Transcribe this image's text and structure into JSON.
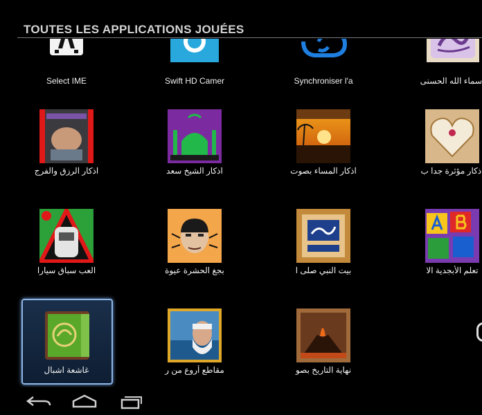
{
  "header": {
    "title": "TOUTES LES APPLICATIONS JOUÉES"
  },
  "apps": [
    {
      "label": "Select IME",
      "icon": "keyboard-icon"
    },
    {
      "label": "Swift HD Camer",
      "icon": "camera-icon"
    },
    {
      "label": "Synchroniser l'a",
      "icon": "sync-cloud-icon"
    },
    {
      "label": "أسماء الله الحسنى",
      "icon": "calligraphy-icon"
    },
    {
      "label": "اذكار الرزق والفرج",
      "icon": "praying-hands-icon"
    },
    {
      "label": "اذكار الشيخ سعد",
      "icon": "mosque-icon"
    },
    {
      "label": "اذكار المساء بصوت",
      "icon": "sunset-icon"
    },
    {
      "label": "اذكار مؤثرة جدا ب",
      "icon": "heart-icon"
    },
    {
      "label": "العب سباق سيارا",
      "icon": "race-car-icon"
    },
    {
      "label": "بجغ الحشرة عيوة",
      "icon": "bug-face-icon"
    },
    {
      "label": "بيت النبي صلى ا",
      "icon": "book-cover-icon"
    },
    {
      "label": "تعلم الأبجدية الا",
      "icon": "alphabet-blocks-icon"
    },
    {
      "label": "غاشعة اشبال",
      "icon": "quran-book-icon"
    },
    {
      "label": "مقاطع أروع من ر",
      "icon": "sheikh-portrait-icon"
    },
    {
      "label": "نهاية التاريخ بصو",
      "icon": "volcano-icon"
    }
  ],
  "nav": {
    "back": "back-icon",
    "home": "home-icon",
    "recents": "recent-apps-icon"
  },
  "colors": {
    "background": "#000000",
    "selection": "#8fb5e6",
    "header_text": "#d4d4d4"
  }
}
